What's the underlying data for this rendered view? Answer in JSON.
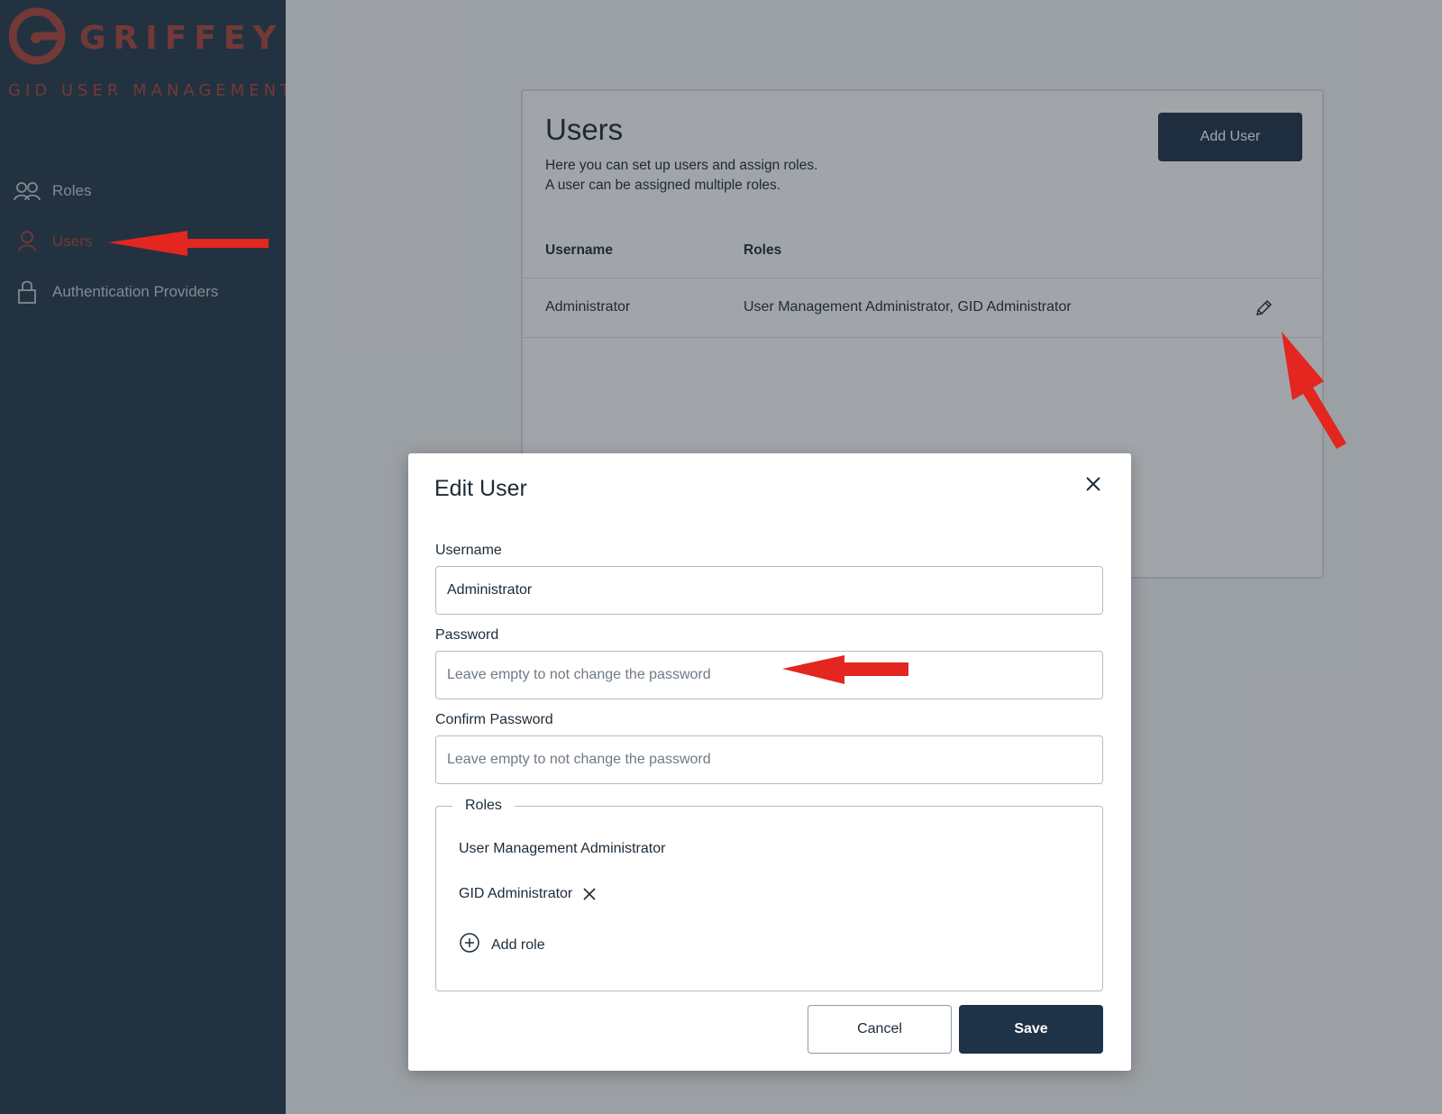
{
  "brand": {
    "logo_text": "GRIFFEYE",
    "subtitle": "GID USER MANAGEMENT",
    "accent_color": "#b0453b",
    "sidebar_color": "#263a4b"
  },
  "sidebar": {
    "items": [
      {
        "label": "Roles",
        "icon": "roles-icon",
        "active": false
      },
      {
        "label": "Users",
        "icon": "user-icon",
        "active": true
      },
      {
        "label": "Authentication Providers",
        "icon": "lock-icon",
        "active": false
      }
    ]
  },
  "users_page": {
    "title": "Users",
    "description_line1": "Here you can set up users and assign roles.",
    "description_line2": "A user can be assigned multiple roles.",
    "add_user_label": "Add User",
    "columns": [
      "Username",
      "Roles"
    ],
    "rows": [
      {
        "username": "Administrator",
        "roles": "User Management Administrator, GID Administrator",
        "action_icon": "pencil-icon"
      }
    ]
  },
  "edit_user_dialog": {
    "title": "Edit User",
    "username_label": "Username",
    "username_value": "Administrator",
    "password_label": "Password",
    "password_placeholder": "Leave empty to not change the password",
    "confirm_password_label": "Confirm Password",
    "confirm_password_placeholder": "Leave empty to not change the password",
    "roles_legend": "Roles",
    "roles": [
      {
        "name": "User Management Administrator",
        "removable": false
      },
      {
        "name": "GID Administrator",
        "removable": true
      }
    ],
    "add_role_label": "Add role",
    "cancel_label": "Cancel",
    "save_label": "Save",
    "primary_color": "#1e3248"
  },
  "annotations": {
    "arrow_color": "#e3261f"
  }
}
